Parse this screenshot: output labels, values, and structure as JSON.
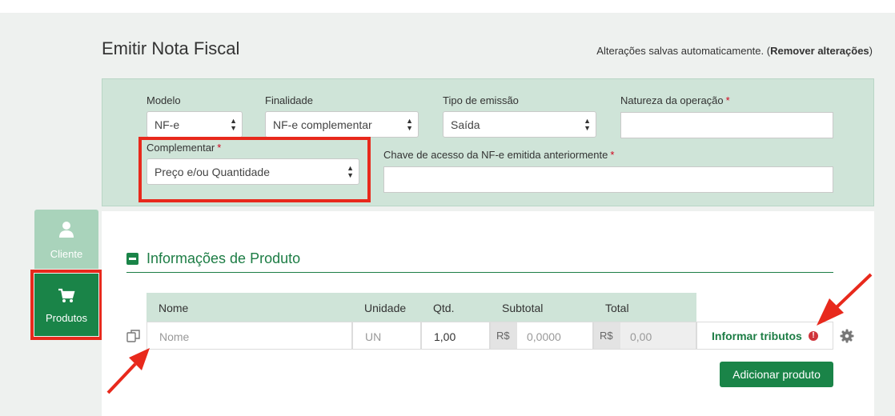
{
  "page": {
    "title": "Emitir Nota Fiscal",
    "autosave_text": "Alterações salvas automaticamente. (",
    "remove_changes": "Remover alterações",
    "autosave_close": ")"
  },
  "form": {
    "modelo": {
      "label": "Modelo",
      "value": "NF-e"
    },
    "finalidade": {
      "label": "Finalidade",
      "value": "NF-e complementar"
    },
    "tipo_emissao": {
      "label": "Tipo de emissão",
      "value": "Saída"
    },
    "natureza": {
      "label": "Natureza da operação",
      "required": "*",
      "value": ""
    },
    "complementar": {
      "label": "Complementar",
      "required": "*",
      "value": "Preço e/ou Quantidade"
    },
    "chave": {
      "label": "Chave de acesso da NF-e emitida anteriormente",
      "required": "*",
      "value": ""
    }
  },
  "sidebar": {
    "items": [
      {
        "label": "Cliente",
        "icon": "user-icon"
      },
      {
        "label": "Produtos",
        "icon": "cart-icon"
      }
    ]
  },
  "product": {
    "section_title": "Informações de Produto",
    "columns": [
      "Nome",
      "Unidade",
      "Qtd.",
      "Subtotal",
      "Total"
    ],
    "row": {
      "nome_placeholder": "Nome",
      "unidade": "UN",
      "qtd": "1,00",
      "currency": "R$",
      "subtotal": "0,0000",
      "total": "0,00"
    },
    "informar_tributos": "Informar tributos",
    "warning_mark": "!",
    "add_button": "Adicionar produto"
  },
  "colors": {
    "brand_green": "#1a8448",
    "panel_green": "#cfe4d8",
    "highlight_red": "#e8291c"
  }
}
